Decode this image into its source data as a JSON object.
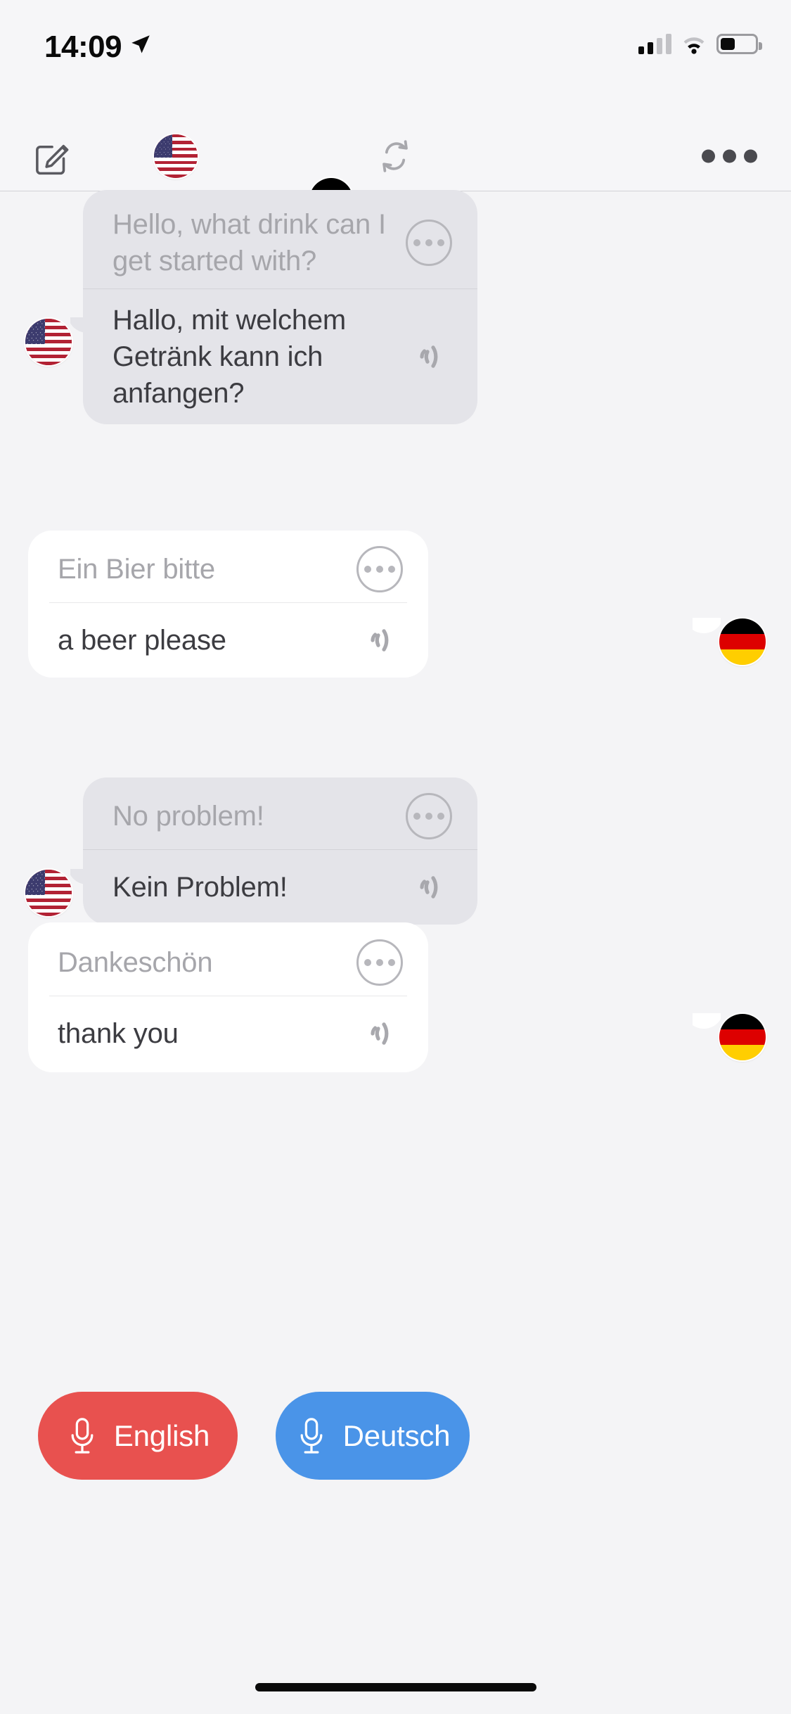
{
  "status_bar": {
    "time": "14:09",
    "location_icon": "location-arrow-icon",
    "signal_icon": "cellular-signal-icon",
    "wifi_icon": "wifi-icon",
    "battery_icon": "battery-icon",
    "battery_level_percent": 38
  },
  "toolbar": {
    "compose_label": "compose-icon",
    "source_flag_label": "us-flag-icon",
    "swap_label": "swap-languages-icon",
    "target_flag_label": "de-flag-icon",
    "more_label": "more-options-icon"
  },
  "conversation": {
    "messages": [
      {
        "side": "incoming",
        "avatar": "us-flag-avatar",
        "source_text": "Hello, what drink can I get started with?",
        "translated_text": "Hallo, mit welchem Getränk kann ich anfangen?",
        "options_icon": "ellipsis-circle-icon",
        "speak_icon": "speaker-waves-icon"
      },
      {
        "side": "outgoing",
        "avatar": "de-flag-avatar",
        "source_text": "Ein Bier bitte",
        "translated_text": "a beer please",
        "options_icon": "ellipsis-circle-icon",
        "speak_icon": "speaker-waves-icon"
      },
      {
        "side": "incoming",
        "avatar": "us-flag-avatar",
        "source_text": "No problem!",
        "translated_text": "Kein Problem!",
        "options_icon": "ellipsis-circle-icon",
        "speak_icon": "speaker-waves-icon"
      },
      {
        "side": "outgoing",
        "avatar": "de-flag-avatar",
        "source_text": "Dankeschön",
        "translated_text": "thank you",
        "options_icon": "ellipsis-circle-icon",
        "speak_icon": "speaker-waves-icon"
      }
    ]
  },
  "mic_bar": {
    "english_label": "English",
    "deutsch_label": "Deutsch",
    "english_color": "#e8514f",
    "deutsch_color": "#4a94e8",
    "mic_icon": "microphone-icon"
  },
  "home_indicator": "home-indicator"
}
